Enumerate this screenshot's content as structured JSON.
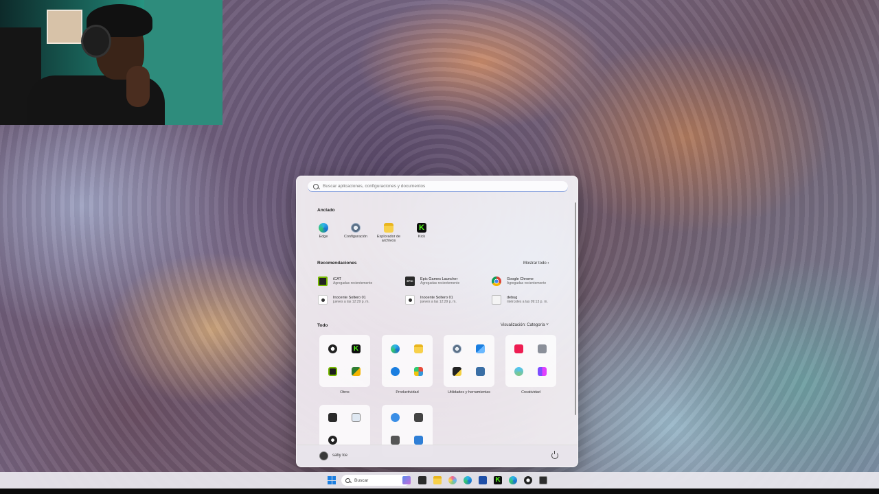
{
  "start_menu": {
    "search_placeholder": "Buscar aplicaciones, configuraciones y documentos",
    "pinned_title": "Anclado",
    "pinned": [
      {
        "label": "Edge",
        "icon": "edge-icon",
        "color": "#1c8ed8"
      },
      {
        "label": "Configuración",
        "icon": "settings-gear-icon",
        "color": "#5a6f86"
      },
      {
        "label": "Explorador de archivos",
        "icon": "folder-icon",
        "color": "#f2c230"
      },
      {
        "label": "Kick",
        "icon": "kick-icon",
        "color": "#53fc18"
      }
    ],
    "recommendations_title": "Recomendaciones",
    "show_all": "Mostrar todo",
    "recommendations": [
      {
        "name": "iCAT",
        "sub": "Agregadas recientemente",
        "icon": "nvidia-icon",
        "color": "#3a7d1e"
      },
      {
        "name": "Epic Games Launcher",
        "sub": "Agregadas recientemente",
        "icon": "epic-games-icon",
        "color": "#2a2a2a"
      },
      {
        "name": "Google Chrome",
        "sub": "Agregadas recientemente",
        "icon": "chrome-icon",
        "color": "#db4437"
      },
      {
        "name": "Inocente Soltero 01",
        "sub": "jueves a las 12:29 p. m.",
        "icon": "media-file-icon",
        "color": "#444444"
      },
      {
        "name": "Inocente Soltero 01",
        "sub": "jueves a las 12:29 p. m.",
        "icon": "media-file-icon",
        "color": "#444444"
      },
      {
        "name": "debug",
        "sub": "miércoles a las 09:13 p. m.",
        "icon": "document-icon",
        "color": "#e6e6e6"
      }
    ],
    "all_title": "Todo",
    "view_mode": "Visualización: Categoría",
    "categories": [
      {
        "label": "Otros"
      },
      {
        "label": "Productividad"
      },
      {
        "label": "Utilidades y herramientas"
      },
      {
        "label": "Creatividad"
      }
    ],
    "user_name": "saby lce"
  },
  "taskbar": {
    "search_label": "Buscar"
  }
}
